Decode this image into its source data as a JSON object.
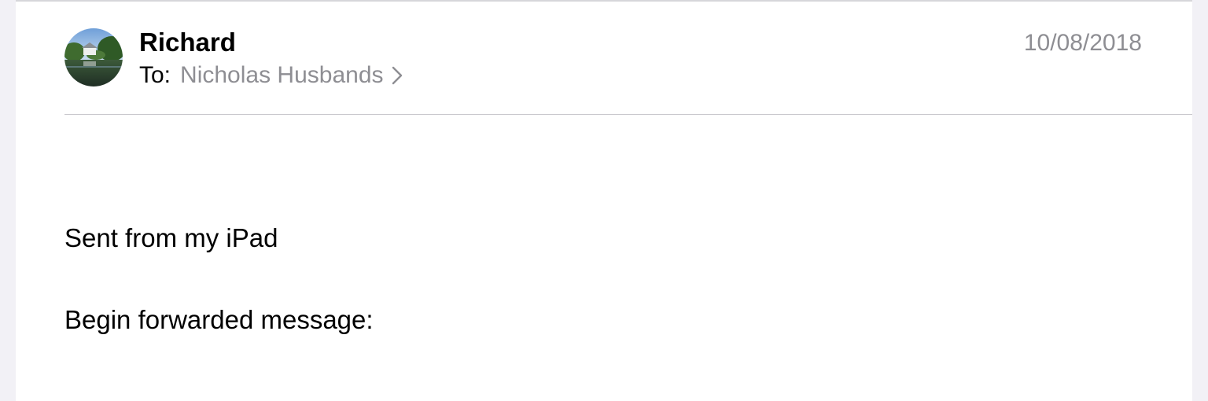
{
  "message": {
    "sender_name": "Richard",
    "to_label": "To:",
    "recipient": "Nicholas Husbands",
    "date": "10/08/2018",
    "body_lines": [
      "Sent from my iPad",
      "Begin forwarded message:"
    ]
  },
  "colors": {
    "background": "#f2f1f6",
    "sheet": "#ffffff",
    "secondary_text": "#8e8e93",
    "divider": "#c8c7cc"
  },
  "icons": {
    "avatar": "sender-photo-avatar",
    "chevron": "chevron-right-icon"
  }
}
